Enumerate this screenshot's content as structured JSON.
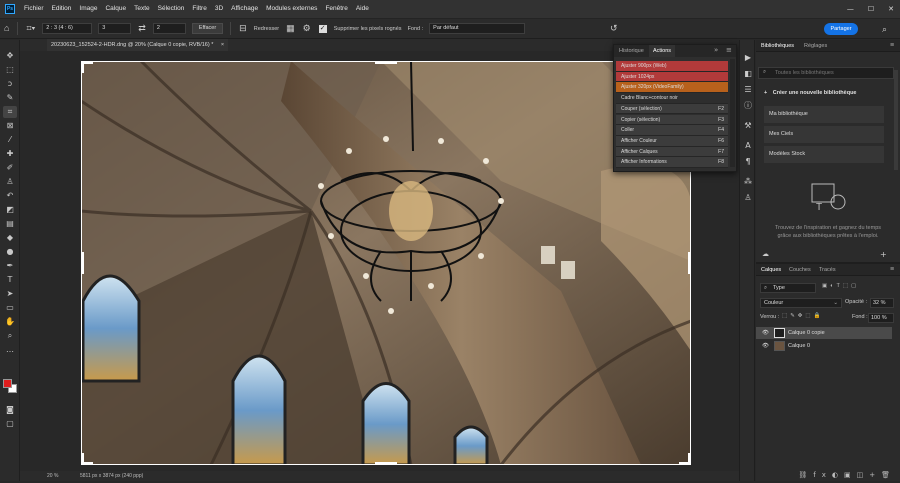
{
  "app": {
    "logo": "Ps"
  },
  "menu": [
    "Fichier",
    "Edition",
    "Image",
    "Calque",
    "Texte",
    "Sélection",
    "Filtre",
    "3D",
    "Affichage",
    "Modules externes",
    "Fenêtre",
    "Aide"
  ],
  "window_controls": {
    "minimize": "—",
    "maximize": "☐",
    "close": "✕"
  },
  "options": {
    "ratio_value": "2 : 3 (4 : 6)",
    "width_value": "3",
    "height_value": "2",
    "clear_label": "Effacer",
    "straighten_label": "Redresser",
    "delete_cropped_label": "Supprimer les pixels rognés",
    "fill_label": "Fond :",
    "fill_value": "Par défaut",
    "share_label": "Partager"
  },
  "document": {
    "tab_title": "20230623_152524-2-HDR.dng @ 20% (Calque 0 copie, RVB/16) *",
    "tab_close": "×",
    "zoom": "20 %",
    "info": "5811 px x 3874 px (240 ppp)"
  },
  "actions_panel": {
    "tab_history": "Historique",
    "tab_actions": "Actions",
    "rows": [
      {
        "label": "Ajuster 900px (Web)",
        "key": "",
        "color": "#b23a3a"
      },
      {
        "label": "Ajuster 1024px",
        "key": "",
        "color": "#b23a3a"
      },
      {
        "label": "Ajuster 320px (VideoFamily)",
        "key": "",
        "color": "#b8611c"
      },
      {
        "label": "Cadre Blanc+contour noir",
        "key": "",
        "color": "#2e2e2e"
      },
      {
        "label": "Couper (sélection)",
        "key": "F2",
        "color": "#3c3c3c"
      },
      {
        "label": "Copier (sélection)",
        "key": "F3",
        "color": "#3c3c3c"
      },
      {
        "label": "Coller",
        "key": "F4",
        "color": "#3c3c3c"
      },
      {
        "label": "Afficher Couleur",
        "key": "F6",
        "color": "#3c3c3c"
      },
      {
        "label": "Afficher Calques",
        "key": "F7",
        "color": "#3c3c3c"
      },
      {
        "label": "Afficher Informations",
        "key": "F8",
        "color": "#3c3c3c"
      }
    ]
  },
  "libraries": {
    "tab_libraries": "Bibliothèques",
    "tab_adjustments": "Réglages",
    "search_placeholder": "Toutes les bibliothèques",
    "create_label": "Créer une nouvelle bibliothèque",
    "items": [
      "Ma bibliothèque",
      "Mes Ciels",
      "Modèles Stock"
    ],
    "promo": "Trouvez de l'inspiration et gagnez du temps grâce aux bibliothèques prêtes à l'emploi."
  },
  "layers": {
    "tab_layers": "Calques",
    "tab_channels": "Couches",
    "tab_paths": "Tracés",
    "filter_label": "Type",
    "blend_mode": "Couleur",
    "opacity_label": "Opacité :",
    "opacity_value": "32 %",
    "lock_label": "Verrou :",
    "fill_label": "Fond :",
    "fill_value": "100 %",
    "items": [
      {
        "name": "Calque 0 copie",
        "selected": true
      },
      {
        "name": "Calque 0",
        "selected": false
      }
    ]
  },
  "colors": {
    "accent": "#1473e6",
    "foreground": "#e01e1e",
    "background": "#ffffff"
  }
}
